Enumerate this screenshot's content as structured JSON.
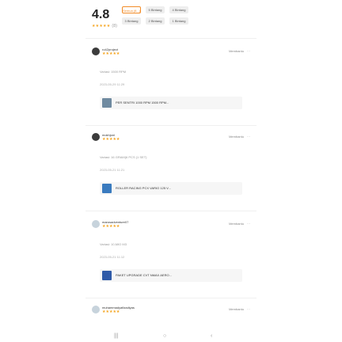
{
  "rating": {
    "score": "4.8",
    "stars": "★★★★★",
    "count": "(8)",
    "filters": [
      {
        "label": "Semua (8...)",
        "active": true
      },
      {
        "label": "5 Bintang",
        "active": false
      },
      {
        "label": "4 Bintang",
        "active": false
      },
      {
        "label": "3 Bintang",
        "active": false
      },
      {
        "label": "2 Bintang",
        "active": false
      },
      {
        "label": "1 Bintang",
        "active": false
      }
    ]
  },
  "reviews": [
    {
      "user": "ro42project",
      "stars": "★★★★★",
      "helpful": "Membantu",
      "variant": "Variasi: 1500 RPM",
      "date": "2023-05-29 11:29",
      "product": "PER SENTRI 1000 RPM 1500 RPM...",
      "avatar": "dark"
    },
    {
      "user": "mokhjoni",
      "stars": "★★★★★",
      "helpful": "Membantu",
      "variant": "Variasi: 16 GRAM(6 PCS (1 SET)",
      "date": "2023-05-21 11:21",
      "product": "ROLLER RACING PCX VARIO 125 V...",
      "avatar": "dark"
    },
    {
      "user": "marosadventure07",
      "stars": "★★★★★",
      "helpful": "Membantu",
      "variant": "Variasi: 10,MIO M3",
      "date": "2023-05-21 11:12",
      "product": "PAKET UPGRADE CVT NMAX AERO...",
      "avatar": "light"
    },
    {
      "user": "muhammadyafizadiyas",
      "stars": "★★★★★",
      "helpful": "Membantu",
      "avatar": "light"
    }
  ],
  "nav": {
    "menu": "|||",
    "home": "○",
    "back": "‹"
  }
}
